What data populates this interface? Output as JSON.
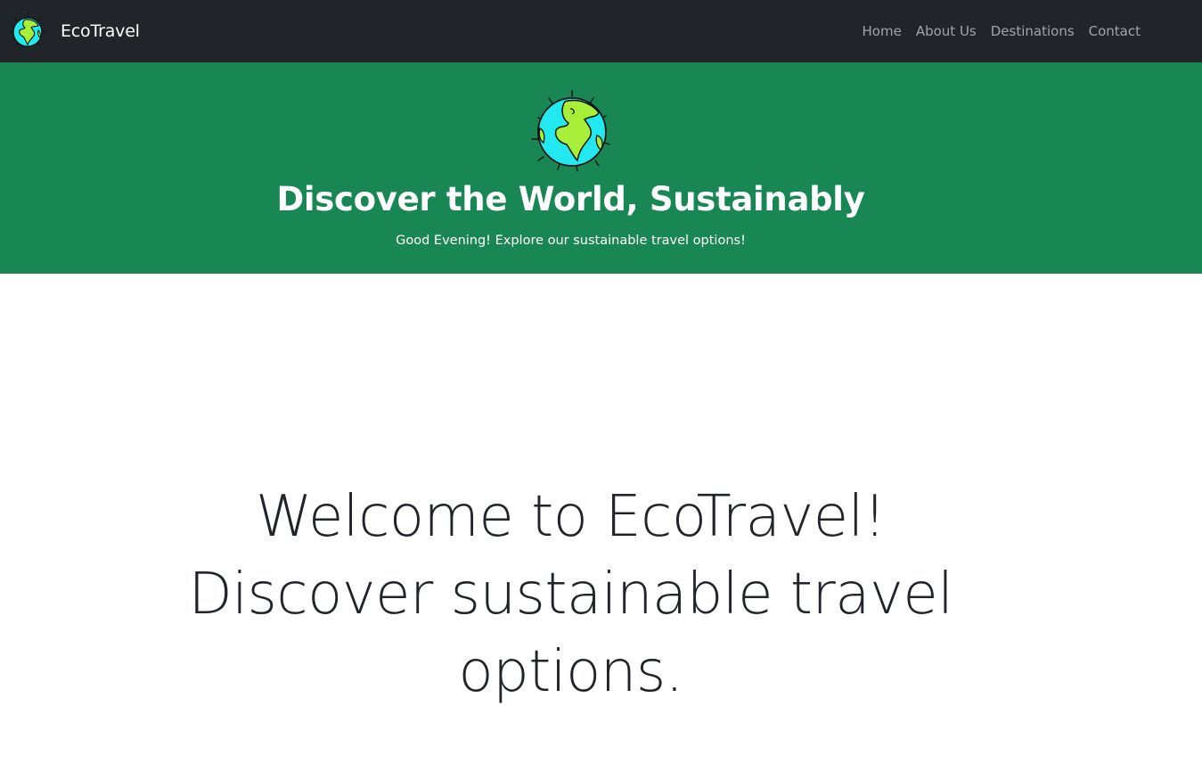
{
  "navbar": {
    "brand_name": "EcoTravel",
    "brand_icon": "globe-icon",
    "links": [
      "Home",
      "About Us",
      "Destinations",
      "Contact"
    ]
  },
  "hero": {
    "icon": "globe-icon",
    "title": "Discover the World, Sustainably",
    "subtitle": "Good Evening! Explore our sustainable travel options!"
  },
  "main": {
    "welcome_text": "Welcome to EcoTravel! Discover sustainable travel options."
  },
  "colors": {
    "navbar_bg": "#212529",
    "hero_bg": "#198754",
    "ocean": "#22e8f0",
    "land": "#a8ef3a"
  }
}
